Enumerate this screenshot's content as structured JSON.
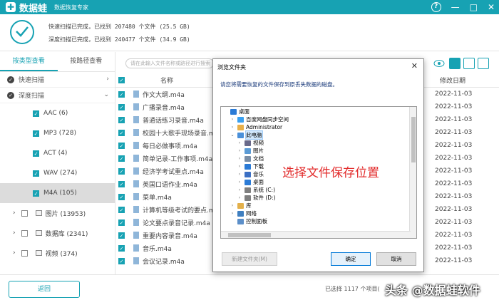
{
  "app": {
    "name": "数据蛙",
    "subtitle": "数据恢复专家",
    "window_controls": [
      "?",
      "—",
      "□",
      "✕"
    ]
  },
  "summary": {
    "quick_scan": "快速扫描已完成，已找到 207480 个文件 (25.5 GB)",
    "deep_scan": "深度扫描已完成，已找到 240477 个文件 (34.9 GB)"
  },
  "sidebar": {
    "tabs": [
      "按类型查看",
      "按路径查看"
    ],
    "active_tab": 0,
    "quick_scan": "快速扫描",
    "deep_scan": "深度扫描",
    "categories": [
      {
        "label": "AAC (6)",
        "selected": false
      },
      {
        "label": "MP3 (728)",
        "selected": false
      },
      {
        "label": "ACT (4)",
        "selected": false
      },
      {
        "label": "WAV (274)",
        "selected": false
      },
      {
        "label": "M4A (105)",
        "selected": true
      }
    ],
    "others": [
      "图片 (13953)",
      "数据库 (2341)",
      "视频 (374)"
    ]
  },
  "toolbar": {
    "search_placeholder": "请在此输入文件名称或路径进行搜索"
  },
  "file_list": {
    "col_name": "名称",
    "col_date": "修改日期",
    "rows": [
      {
        "name": "作文大纲.m4a",
        "date": "2022-11-03"
      },
      {
        "name": "广播录音.m4a",
        "date": "2022-11-03"
      },
      {
        "name": "普通话练习录音.m4a",
        "date": "2022-11-03"
      },
      {
        "name": "校园十大歌手现场录音.m4a",
        "date": "2022-11-03"
      },
      {
        "name": "每日必做事项.m4a",
        "date": "2022-11-03"
      },
      {
        "name": "简单记录-工作事项.m4a",
        "date": "2022-11-03"
      },
      {
        "name": "经济学考试重点.m4a",
        "date": "2022-11-03"
      },
      {
        "name": "英国口语作业.m4a",
        "date": "2022-11-03"
      },
      {
        "name": "菜单.m4a",
        "date": "2022-11-03"
      },
      {
        "name": "计算机等级考试的要点.m4a",
        "date": "2022-11-03"
      },
      {
        "name": "论文要点录音记录.m4a",
        "date": "2022-11-03"
      },
      {
        "name": "重要内容录音.m4a",
        "date": "2022-11-03"
      },
      {
        "name": "音乐.m4a",
        "date": "2022-11-03"
      },
      {
        "name": "会议记录.m4a",
        "date": "2022-11-03"
      }
    ]
  },
  "bottom": {
    "back_label": "返回",
    "selected_info": "已选择 1117 个项目(",
    "watermark": "头条 @数据蛙软件"
  },
  "dialog": {
    "title": "浏览文件夹",
    "close": "✕",
    "description": "请您将需要恢复的文件保存到原丢失数据的磁盘。",
    "overlay_label": "选择文件保存位置",
    "tree": [
      {
        "label": "桌面",
        "indent": 0,
        "expander": "",
        "icon": "desktop"
      },
      {
        "label": "百度网盘同步空间",
        "indent": 1,
        "expander": "›",
        "icon": "cloud"
      },
      {
        "label": "Administrator",
        "indent": 1,
        "expander": "›",
        "icon": "user"
      },
      {
        "label": "此电脑",
        "indent": 1,
        "expander": "⌄",
        "icon": "pc",
        "selected": true
      },
      {
        "label": "视频",
        "indent": 2,
        "expander": "›",
        "icon": "video"
      },
      {
        "label": "图片",
        "indent": 2,
        "expander": "›",
        "icon": "picture"
      },
      {
        "label": "文档",
        "indent": 2,
        "expander": "›",
        "icon": "doc"
      },
      {
        "label": "下载",
        "indent": 2,
        "expander": "›",
        "icon": "download"
      },
      {
        "label": "音乐",
        "indent": 2,
        "expander": "›",
        "icon": "music"
      },
      {
        "label": "桌面",
        "indent": 2,
        "expander": "›",
        "icon": "desktop"
      },
      {
        "label": "系统 (C:)",
        "indent": 2,
        "expander": "›",
        "icon": "drive"
      },
      {
        "label": "软件 (D:)",
        "indent": 2,
        "expander": "›",
        "icon": "drive"
      },
      {
        "label": "库",
        "indent": 1,
        "expander": "›",
        "icon": "library"
      },
      {
        "label": "网络",
        "indent": 1,
        "expander": "›",
        "icon": "network"
      },
      {
        "label": "控制面板",
        "indent": 1,
        "expander": "",
        "icon": "control"
      }
    ],
    "new_folder": "新建文件夹(M)",
    "ok": "确定",
    "cancel": "取消"
  },
  "colors": {
    "accent": "#17a2b3",
    "overlay_text": "#e22b2b"
  }
}
